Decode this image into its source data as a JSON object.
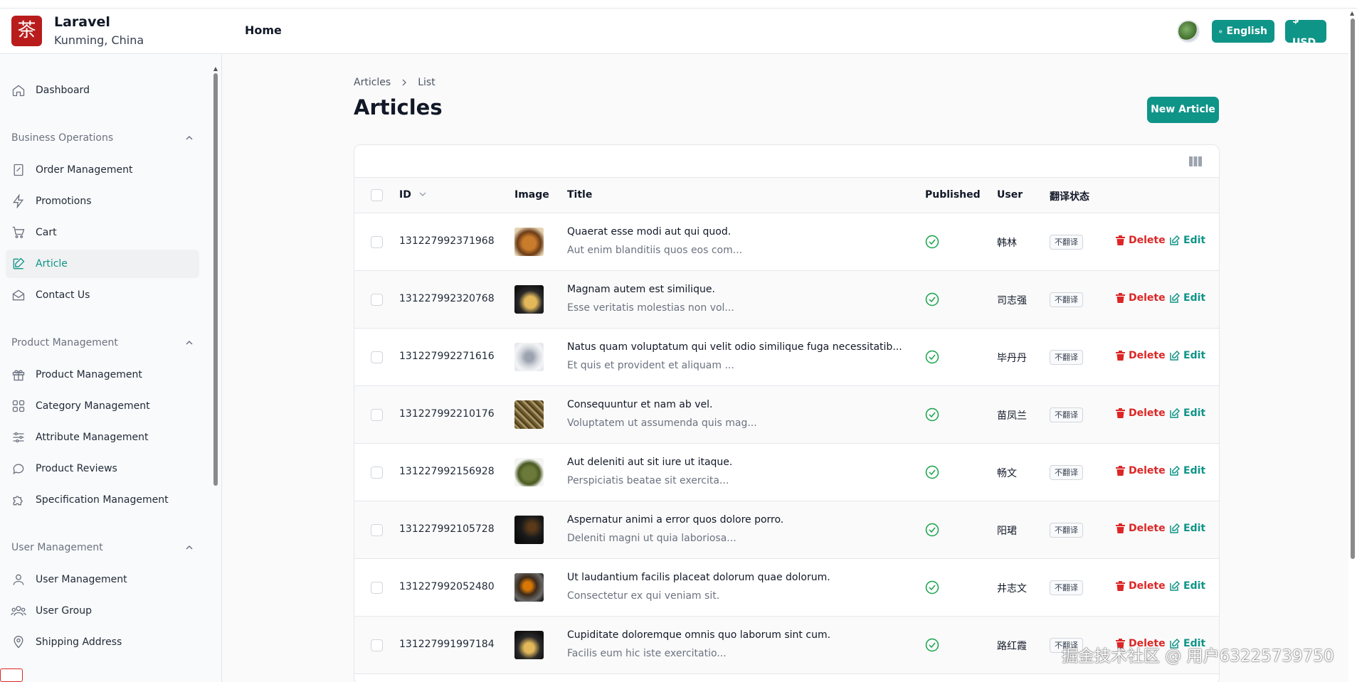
{
  "header": {
    "logo_char": "茶",
    "brand_name": "Laravel",
    "brand_location": "Kunming, China",
    "nav_home": "Home",
    "language_label": "English",
    "currency_label": "$ USD"
  },
  "sidebar": {
    "dashboard": "Dashboard",
    "sections": [
      {
        "title": "Business Operations",
        "items": [
          "Order Management",
          "Promotions",
          "Cart",
          "Article",
          "Contact Us"
        ]
      },
      {
        "title": "Product Management",
        "items": [
          "Product Management",
          "Category Management",
          "Attribute Management",
          "Product Reviews",
          "Specification Management"
        ]
      },
      {
        "title": "User Management",
        "items": [
          "User Management",
          "User Group",
          "Shipping Address"
        ]
      }
    ],
    "active_item": "Article"
  },
  "breadcrumb": {
    "parent": "Articles",
    "current": "List"
  },
  "page": {
    "title": "Articles",
    "new_button": "New Article"
  },
  "table": {
    "headers": {
      "id": "ID",
      "image": "Image",
      "title": "Title",
      "published": "Published",
      "user": "User",
      "translation": "翻译状态"
    },
    "delete_label": "Delete",
    "edit_label": "Edit",
    "rows": [
      {
        "id": "131227992371968",
        "title": "Quaerat esse modi aut qui quod.",
        "excerpt": "Aut enim blanditiis quos eos com...",
        "user": "韩林",
        "status": "不翻译"
      },
      {
        "id": "131227992320768",
        "title": "Magnam autem est similique.",
        "excerpt": "Esse veritatis molestias non vol...",
        "user": "司志强",
        "status": "不翻译"
      },
      {
        "id": "131227992271616",
        "title": "Natus quam voluptatum qui velit odio similique fuga necessitatib...",
        "excerpt": "Et quis et provident et aliquam ...",
        "user": "毕丹丹",
        "status": "不翻译"
      },
      {
        "id": "131227992210176",
        "title": "Consequuntur et nam ab vel.",
        "excerpt": "Voluptatem ut assumenda quis mag...",
        "user": "苗凤兰",
        "status": "不翻译"
      },
      {
        "id": "131227992156928",
        "title": "Aut deleniti aut sit iure ut itaque.",
        "excerpt": "Perspiciatis beatae sit exercita...",
        "user": "畅文",
        "status": "不翻译"
      },
      {
        "id": "131227992105728",
        "title": "Aspernatur animi a error quos dolore porro.",
        "excerpt": "Deleniti magni ut quia laboriosa...",
        "user": "阳珺",
        "status": "不翻译"
      },
      {
        "id": "131227992052480",
        "title": "Ut laudantium facilis placeat dolorum quae dolorum.",
        "excerpt": "Consectetur ex qui veniam sit.",
        "user": "井志文",
        "status": "不翻译"
      },
      {
        "id": "131227991997184",
        "title": "Cupiditate doloremque omnis quo laborum sint cum.",
        "excerpt": "Facilis eum hic iste exercitatio...",
        "user": "路红霞",
        "status": "不翻译"
      }
    ]
  },
  "watermark": "掘金技术社区 @ 用户63225739750",
  "colors": {
    "accent": "#0f9488",
    "danger": "#dc2626",
    "logo": "#b91c1c"
  }
}
